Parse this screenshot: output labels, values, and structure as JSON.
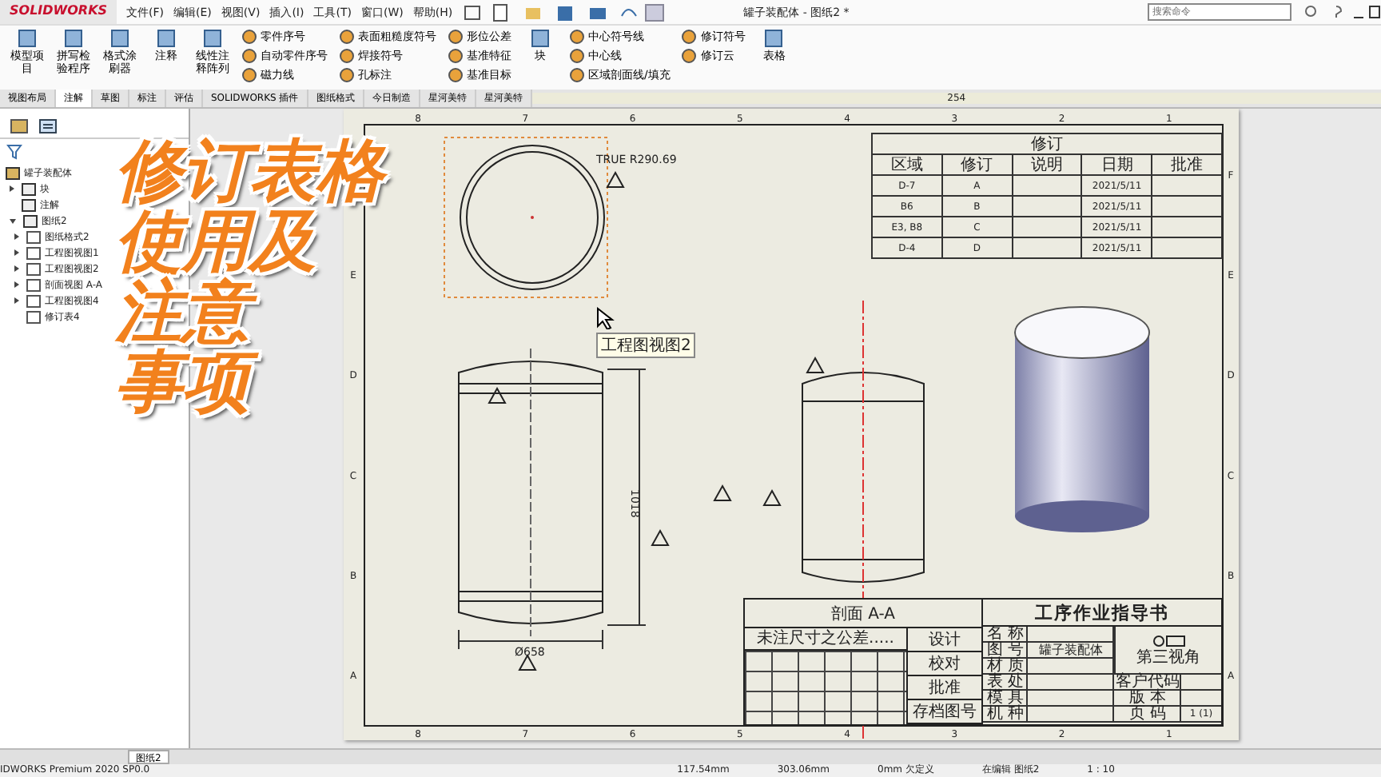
{
  "app": {
    "logo": "SOLIDWORKS",
    "menus": [
      "文件(F)",
      "编辑(E)",
      "视图(V)",
      "插入(I)",
      "工具(T)",
      "窗口(W)",
      "帮助(H)"
    ],
    "doc_title": "罐子装配体 - 图纸2 *",
    "search": {
      "placeholder": "搜索命令"
    }
  },
  "ribbon": [
    {
      "kind": "large",
      "items": [
        "模型项目"
      ]
    },
    {
      "kind": "large",
      "items": [
        "拼写检验程序"
      ]
    },
    {
      "kind": "large",
      "items": [
        "格式涂刷器"
      ]
    },
    {
      "kind": "large",
      "items": [
        "注释"
      ]
    },
    {
      "kind": "large",
      "items": [
        "线性注释阵列"
      ]
    },
    {
      "kind": "small",
      "items": [
        "零件序号",
        "自动零件序号",
        "磁力线"
      ]
    },
    {
      "kind": "small",
      "items": [
        "表面粗糙度符号",
        "焊接符号",
        "孔标注"
      ]
    },
    {
      "kind": "small",
      "items": [
        "形位公差",
        "基准特征",
        "基准目标"
      ]
    },
    {
      "kind": "large",
      "items": [
        "块"
      ]
    },
    {
      "kind": "small",
      "items": [
        "中心符号线",
        "中心线",
        "区域剖面线/填充"
      ]
    },
    {
      "kind": "small",
      "items": [
        "修订符号",
        "修订云"
      ]
    },
    {
      "kind": "large",
      "items": [
        "表格"
      ]
    }
  ],
  "tabs": [
    {
      "label": "视图布局",
      "selected": false
    },
    {
      "label": "注解",
      "selected": true
    },
    {
      "label": "草图",
      "selected": false
    },
    {
      "label": "标注",
      "selected": false
    },
    {
      "label": "评估",
      "selected": false
    },
    {
      "label": "SOLIDWORKS 插件",
      "selected": false
    },
    {
      "label": "图纸格式",
      "selected": false
    },
    {
      "label": "今日制造",
      "selected": false
    },
    {
      "label": "星河美特",
      "selected": false
    },
    {
      "label": "星河美特",
      "selected": false
    }
  ],
  "ruler": {
    "reading": "254"
  },
  "tree": {
    "label": "罐子装配体",
    "children": [
      {
        "label": "块",
        "expanded": false
      },
      {
        "label": "注解"
      },
      {
        "label": "图纸2",
        "expanded": true,
        "children": [
          {
            "label": "图纸格式2",
            "expanded": false
          },
          {
            "label": "工程图视图1",
            "expanded": false
          },
          {
            "label": "工程图视图2",
            "expanded": false
          },
          {
            "label": "剖面视图 A-A",
            "expanded": false
          },
          {
            "label": "工程图视图4",
            "expanded": false
          },
          {
            "label": "修订表4"
          }
        ]
      }
    ]
  },
  "overlay_title": [
    "修订表格",
    "使用及",
    "注意",
    "事项"
  ],
  "sheet": {
    "top_zones": [
      "8",
      "7",
      "6",
      "5",
      "4",
      "3",
      "2",
      "1"
    ],
    "bottom_zones": [
      "8",
      "7",
      "6",
      "5",
      "4",
      "3",
      "2",
      "1"
    ],
    "left_zones": [
      "E",
      "D",
      "C",
      "B",
      "A"
    ],
    "right_zones": [
      "F",
      "E",
      "D",
      "C",
      "B",
      "A"
    ],
    "circle_note": "TRUE R290.69",
    "tooltip": "工程图视图2",
    "height_dim": "1018",
    "diameter_dim": "Ø658",
    "section_label": "剖面 A-A"
  },
  "revision_table": {
    "title": "修订",
    "columns": [
      "区域",
      "修订",
      "说明",
      "日期",
      "批准"
    ],
    "rows": [
      [
        "D-7",
        "A",
        "2021/5/11"
      ],
      [
        "B6",
        "B",
        "2021/5/11"
      ],
      [
        "E3, B8",
        "C",
        "2021/5/11"
      ],
      [
        "D-4",
        "D",
        "2021/5/11"
      ]
    ]
  },
  "title_block": {
    "tolerance_title": "未注尺寸之公差.....",
    "approvals": [
      "设计",
      "校对",
      "批准",
      "存档图号"
    ],
    "heading": "工序作业指导书",
    "fields": [
      {
        "label": "名 称"
      },
      {
        "label": "图 号",
        "value": "罐子装配体"
      },
      {
        "label": "材 质"
      },
      {
        "label": "表 处"
      },
      {
        "label": "模 具"
      },
      {
        "label": "机 种"
      }
    ],
    "sub_fields": [
      {
        "label": "客户代码"
      },
      {
        "label": "版 本"
      },
      {
        "label": "页 码",
        "value": "1 (1)"
      }
    ],
    "projection": "第三视角"
  },
  "sheet_tabs": [
    {
      "label": "图纸2",
      "selected": true
    }
  ],
  "status": [
    "IDWORKS Premium 2020 SP0.0",
    "117.54mm",
    "303.06mm",
    "0mm 欠定义",
    "在编辑 图纸2",
    "1 : 10"
  ]
}
